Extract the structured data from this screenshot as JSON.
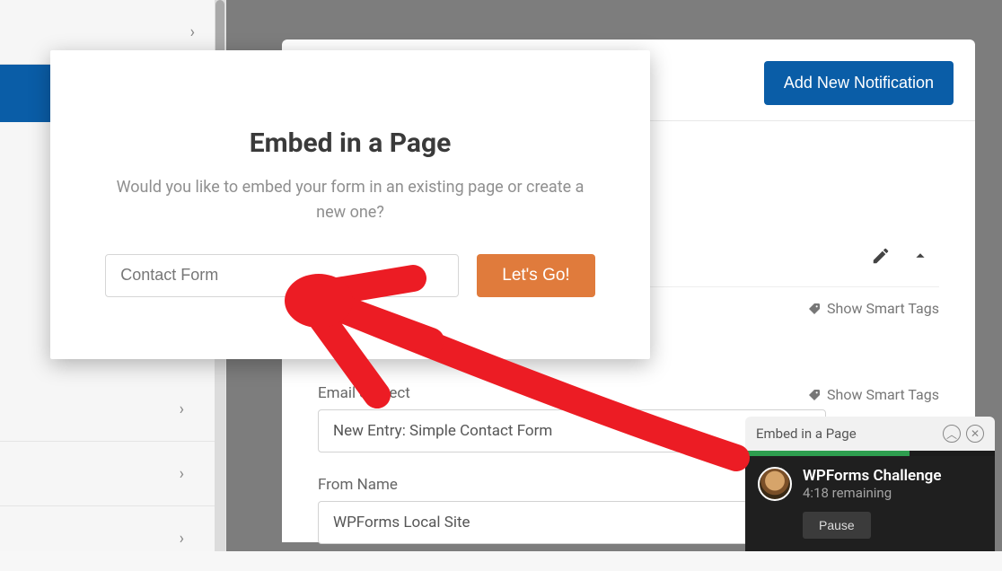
{
  "modal": {
    "title": "Embed in a Page",
    "subtitle": "Would you like to embed your form in an existing page or create a new one?",
    "input_value": "Contact Form",
    "go_label": "Let's Go!"
  },
  "header": {
    "add_notification_label": "Add New Notification"
  },
  "smart_tags_label": "Show Smart Tags",
  "form": {
    "email_subject_label": "Email Subject",
    "email_subject_value": "New Entry: Simple Contact Form",
    "from_name_label": "From Name",
    "from_name_value": "WPForms Local Site"
  },
  "challenge": {
    "header": "Embed in a Page",
    "title": "WPForms Challenge",
    "remaining": "4:18 remaining",
    "pause_label": "Pause"
  }
}
